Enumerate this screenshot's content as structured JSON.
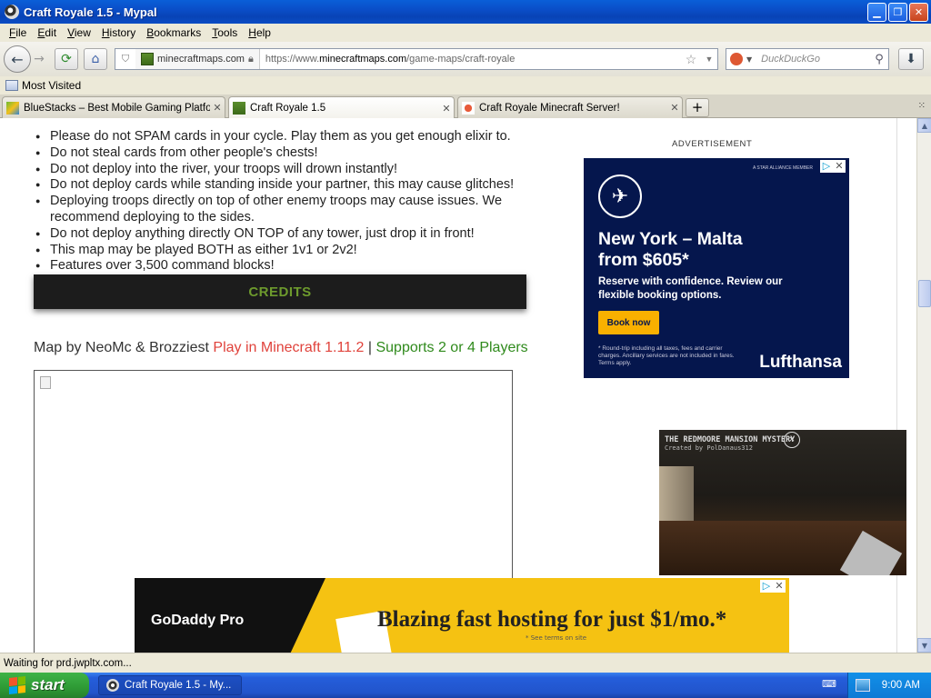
{
  "window": {
    "title": "Craft Royale 1.5 - Mypal",
    "min_icon": "minimize-icon",
    "max_icon": "restore-icon",
    "close_icon": "close-icon"
  },
  "menu": [
    "File",
    "Edit",
    "View",
    "History",
    "Bookmarks",
    "Tools",
    "Help"
  ],
  "nav": {
    "site_identity": "minecraftmaps.com",
    "url_host": "https://www.",
    "url_domain": "minecraftmaps.com",
    "url_path": "/game-maps/craft-royale",
    "search_placeholder": "DuckDuckGo"
  },
  "bookmarks": {
    "most_visited": "Most Visited"
  },
  "tabs": [
    {
      "label": "BlueStacks – Best Mobile Gaming Platform...",
      "active": false
    },
    {
      "label": "Craft Royale 1.5",
      "active": true
    },
    {
      "label": "Craft Royale Minecraft Server!",
      "active": false
    }
  ],
  "page": {
    "rules": [
      "Please do not SPAM cards in your cycle. Play them as you get enough elixir to.",
      "Do not steal cards from other people's chests!",
      "Do not deploy into the river, your troops will drown instantly!",
      "Do not deploy cards while standing inside your partner, this may cause glitches!",
      "Deploying troops directly on top of other enemy troops may cause issues. We recommend deploying to the sides.",
      "Do not deploy anything directly ON TOP of any tower, just drop it in front!",
      "This map may be played BOTH as either 1v1 or 2v2!",
      "Features over 3,500 command blocks!"
    ],
    "credits_label": "CREDITS",
    "map_by": "Map by NeoMc & Brozziest ",
    "play_in": "Play in Minecraft 1.11.2",
    "separator": " | ",
    "supports": "Supports 2 or 4 Players",
    "advertisement_label": "ADVERTISEMENT"
  },
  "ads": {
    "lufthansa": {
      "alliance": "A STAR ALLIANCE MEMBER",
      "title_line1": "New York – Malta",
      "title_line2": "from $605*",
      "subtitle": "Reserve with confidence. Review our flexible booking options.",
      "cta": "Book now",
      "fine_print": "* Round-trip including all taxes, fees and carrier charges. Ancillary services are not included in fares. Terms apply.",
      "brand": "Lufthansa",
      "color": "#05164d"
    },
    "video": {
      "title": "THE REDMOORE MANSION MYSTERY",
      "subtitle": "Created by PolDanaus312"
    },
    "godaddy": {
      "logo": "GoDaddy Pro",
      "headline": "Blazing fast hosting for just $1/mo.*",
      "fine_print": "* See terms on site",
      "color": "#f5c212"
    }
  },
  "status": {
    "text": "Waiting for prd.jwpltx.com..."
  },
  "taskbar": {
    "start": "start",
    "task": "Craft Royale 1.5 - My...",
    "clock": "9:00 AM"
  }
}
